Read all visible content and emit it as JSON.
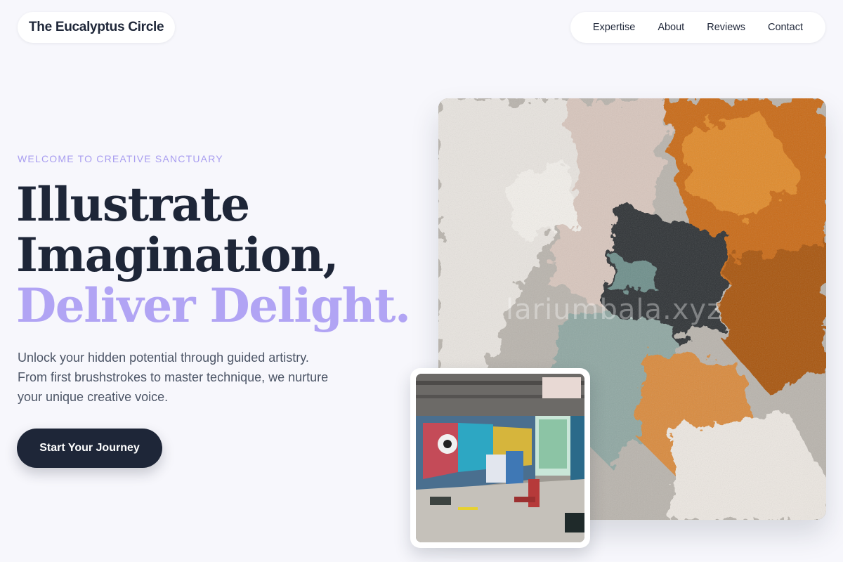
{
  "brand": {
    "name": "The Eucalyptus Circle"
  },
  "nav": {
    "items": [
      {
        "label": "Expertise"
      },
      {
        "label": "About"
      },
      {
        "label": "Reviews"
      },
      {
        "label": "Contact"
      }
    ]
  },
  "hero": {
    "eyebrow": "WELCOME TO CREATIVE SANCTUARY",
    "headline_line1": "Illustrate",
    "headline_line2": "Imagination,",
    "headline_accent": "Deliver Delight.",
    "lede": "Unlock your hidden potential through guided artistry. From first brushstrokes to master technique, we nurture your unique creative voice.",
    "cta_label": "Start Your Journey"
  },
  "images": {
    "main_watermark": "lariumbala.xyz"
  },
  "colors": {
    "accent": "#b1a4f4",
    "eyebrow": "#a99ef0",
    "ink": "#1e2638",
    "background": "#f7f7fc"
  }
}
